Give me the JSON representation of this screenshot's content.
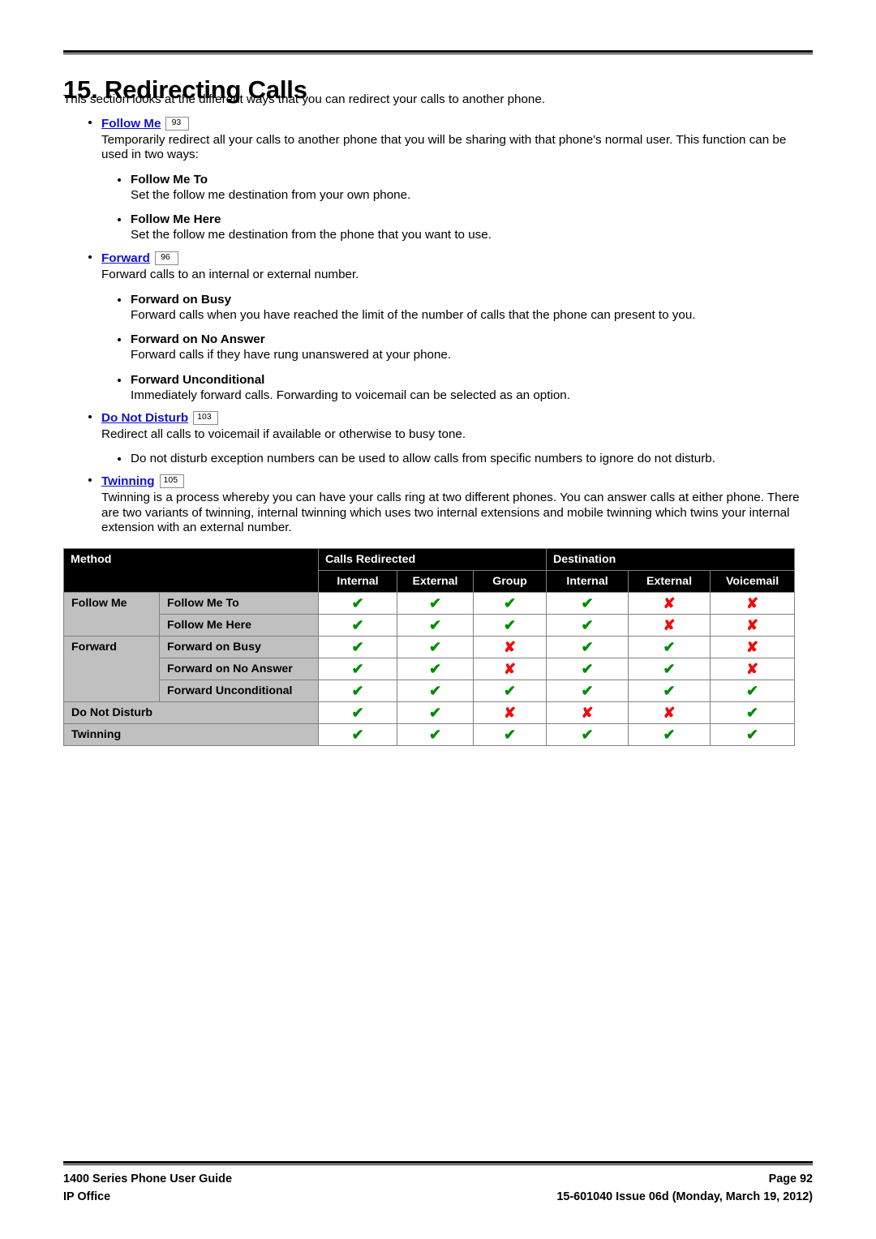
{
  "document": {
    "chapter_title": "15. Redirecting Calls",
    "intro": "This section looks at the different ways that you can redirect your calls to another phone."
  },
  "sections": [
    {
      "link_label": "Follow Me",
      "page_ref": "93",
      "body": "Temporarily redirect all your calls to another phone that you will be sharing with that phone's normal user. This function can be used in two ways:",
      "items": [
        {
          "title": "Follow Me To",
          "body": "Set the follow me destination from your own phone."
        },
        {
          "title": "Follow Me Here",
          "body": "Set the follow me destination from the phone that you want to use."
        }
      ]
    },
    {
      "link_label": "Forward",
      "page_ref": "96",
      "body": "Forward calls to an internal or external number.",
      "items": [
        {
          "title": "Forward on Busy",
          "body": "Forward calls when you have reached the limit of the number of calls that the phone can present to you."
        },
        {
          "title": "Forward on No Answer",
          "body": "Forward calls if they have rung unanswered at your phone."
        },
        {
          "title": "Forward Unconditional",
          "body": "Immediately forward calls. Forwarding to voicemail can be selected as an option."
        }
      ]
    },
    {
      "link_label": "Do Not Disturb",
      "page_ref": "103",
      "body": "Redirect all calls to voicemail if available or otherwise to busy tone.",
      "plain_items": [
        "Do not disturb exception numbers can be used to allow calls from specific numbers to ignore do not disturb."
      ]
    },
    {
      "link_label": "Twinning",
      "page_ref": "105",
      "body": "Twinning is a process whereby you can have your calls ring at two different phones. You can answer calls at either phone. There are two variants of twinning, internal twinning which uses two internal extensions and mobile twinning which twins your internal extension with an external number."
    }
  ],
  "table": {
    "headers": {
      "method": "Method",
      "calls_redirected": "Calls Redirected",
      "destination": "Destination",
      "sub": [
        "Internal",
        "External",
        "Group",
        "Internal",
        "External",
        "Voicemail"
      ]
    },
    "groups": [
      {
        "label": "Follow Me",
        "span": 2
      },
      {
        "label": "Forward",
        "span": 3
      }
    ],
    "rows": [
      {
        "group": "Follow Me",
        "label": "Follow Me To",
        "marks": [
          "yes",
          "yes",
          "yes",
          "yes",
          "no",
          "no"
        ]
      },
      {
        "group": "Follow Me",
        "label": "Follow Me Here",
        "marks": [
          "yes",
          "yes",
          "yes",
          "yes",
          "no",
          "no"
        ]
      },
      {
        "group": "Forward",
        "label": "Forward on Busy",
        "marks": [
          "yes",
          "yes",
          "no",
          "yes",
          "yes",
          "no"
        ]
      },
      {
        "group": "Forward",
        "label": "Forward on No Answer",
        "marks": [
          "yes",
          "yes",
          "no",
          "yes",
          "yes",
          "no"
        ]
      },
      {
        "group": "Forward",
        "label": "Forward Unconditional",
        "marks": [
          "yes",
          "yes",
          "yes",
          "yes",
          "yes",
          "yes"
        ]
      },
      {
        "group": null,
        "label": "Do Not Disturb",
        "full": true,
        "marks": [
          "yes",
          "yes",
          "no",
          "no",
          "no",
          "yes"
        ]
      },
      {
        "group": null,
        "label": "Twinning",
        "full": true,
        "marks": [
          "yes",
          "yes",
          "yes",
          "yes",
          "yes",
          "yes"
        ]
      }
    ],
    "glyphs": {
      "yes": "✔",
      "no": "✘"
    },
    "colors": {
      "yes": "#018b01",
      "no": "#f20a0a",
      "header_bg": "#000000",
      "label_bg": "#c0c0c0"
    }
  },
  "footer": {
    "left_line1": "1400 Series Phone User Guide",
    "left_line2": "IP Office",
    "right_line1": "Page 92",
    "right_line2": "15-601040 Issue 06d (Monday, March 19, 2012)"
  }
}
